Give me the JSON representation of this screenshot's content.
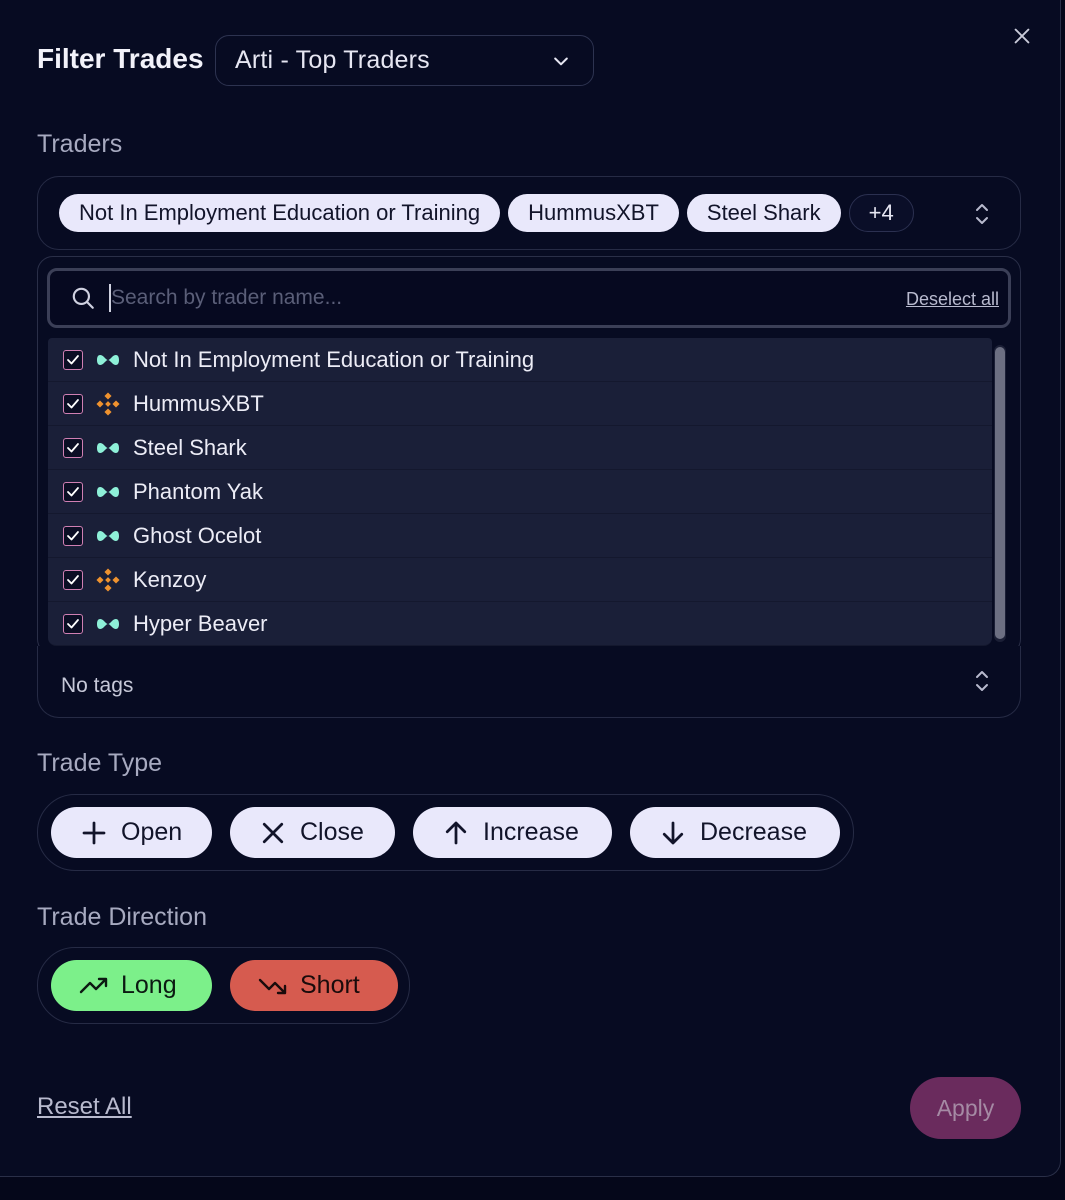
{
  "header": {
    "title": "Filter Trades",
    "preset_value": "Arti - Top Traders"
  },
  "traders": {
    "label": "Traders",
    "selected_chips": [
      "Not In Employment Education or Training",
      "HummusXBT",
      "Steel Shark"
    ],
    "more_count": "+4",
    "search_placeholder": "Search by trader name...",
    "deselect_all": "Deselect all",
    "list": [
      {
        "name": "Not In Employment Education or Training",
        "exchange_icon": "hyperliquid-icon",
        "checked": true
      },
      {
        "name": "HummusXBT",
        "exchange_icon": "binance-icon",
        "checked": true
      },
      {
        "name": "Steel Shark",
        "exchange_icon": "hyperliquid-icon",
        "checked": true
      },
      {
        "name": "Phantom Yak",
        "exchange_icon": "hyperliquid-icon",
        "checked": true
      },
      {
        "name": "Ghost Ocelot",
        "exchange_icon": "hyperliquid-icon",
        "checked": true
      },
      {
        "name": "Kenzoy",
        "exchange_icon": "binance-icon",
        "checked": true
      },
      {
        "name": "Hyper Beaver",
        "exchange_icon": "hyperliquid-icon",
        "checked": true
      }
    ]
  },
  "tags": {
    "value": "No tags"
  },
  "trade_type": {
    "label": "Trade Type",
    "options": [
      "Open",
      "Close",
      "Increase",
      "Decrease"
    ]
  },
  "trade_direction": {
    "label": "Trade Direction",
    "long": "Long",
    "short": "Short"
  },
  "footer": {
    "reset": "Reset All",
    "apply": "Apply"
  },
  "colors": {
    "background": "#070b22",
    "chip": "#e9e8fb",
    "long": "#7cf08a",
    "short": "#d65b4f",
    "apply": "#6a2b5d",
    "checkbox_border": "#d07fb3",
    "hyperliquid": "#8ef0d8",
    "binance": "#f0922e"
  }
}
